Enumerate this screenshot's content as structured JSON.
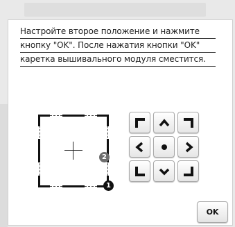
{
  "message": {
    "lines": [
      "Настройте второе положение и нажмите",
      "кнопку \"OK\". После нажатия кнопки \"OK\"",
      "каретка вышивального модуля сместится."
    ]
  },
  "markers": {
    "first": "1",
    "second": "2"
  },
  "pad": {
    "buttons": [
      {
        "name": "move-up-left-button",
        "icon": "corner-up-left-icon"
      },
      {
        "name": "move-up-button",
        "icon": "chevron-up-icon"
      },
      {
        "name": "move-up-right-button",
        "icon": "corner-up-right-icon"
      },
      {
        "name": "move-left-button",
        "icon": "chevron-left-icon"
      },
      {
        "name": "center-button",
        "icon": "dot-icon"
      },
      {
        "name": "move-right-button",
        "icon": "chevron-right-icon"
      },
      {
        "name": "move-down-left-button",
        "icon": "corner-down-left-icon"
      },
      {
        "name": "move-down-button",
        "icon": "chevron-down-icon"
      },
      {
        "name": "move-down-right-button",
        "icon": "corner-down-right-icon"
      }
    ]
  },
  "ok_label": "OK"
}
